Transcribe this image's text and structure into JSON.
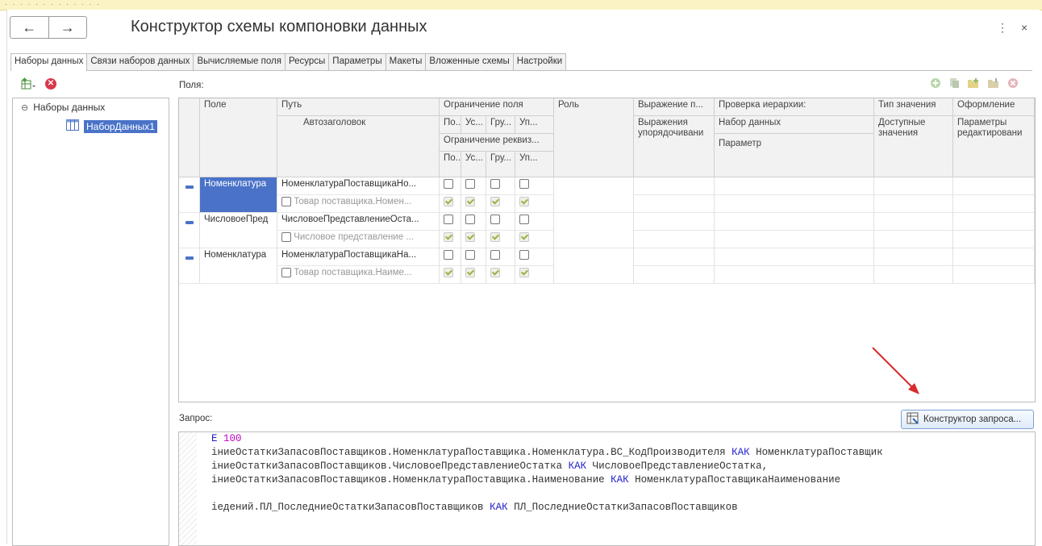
{
  "window": {
    "title": "Конструктор схемы компоновки данных",
    "back_icon": "←",
    "forward_icon": "→",
    "more_icon": "⋮",
    "close_icon": "×"
  },
  "tabs": [
    {
      "label": "Наборы данных",
      "active": true
    },
    {
      "label": "Связи наборов данных"
    },
    {
      "label": "Вычисляемые поля"
    },
    {
      "label": "Ресурсы"
    },
    {
      "label": "Параметры"
    },
    {
      "label": "Макеты"
    },
    {
      "label": "Вложенные схемы"
    },
    {
      "label": "Настройки"
    }
  ],
  "tree": {
    "root": "Наборы данных",
    "collapse_icon": "⊖",
    "item": "НаборДанных1"
  },
  "fields_label": "Поля:",
  "grid": {
    "headers": {
      "field": "Поле",
      "path": "Путь",
      "autotitle": "Автозаголовок",
      "field_restriction": "Ограничение поля",
      "attr_restriction": "Ограничение реквиз...",
      "r1": "По...",
      "r2": "Ус...",
      "r3": "Гру...",
      "r4": "Уп...",
      "role": "Роль",
      "expr_p": "Выражение п...",
      "expr_order": "Выражения упорядочивани",
      "hier_check": "Проверка иерархии:",
      "dataset": "Набор данных",
      "param": "Параметр",
      "value_type": "Тип значения",
      "avail_values": "Доступные значения",
      "format": "Оформление",
      "edit_params": "Параметры редактировани"
    },
    "rows": [
      {
        "field": "Номенклатура",
        "path": "НоменклатураПоставщикаНо...",
        "title": "Товар поставщика.Номен..."
      },
      {
        "field": "ЧисловоеПред",
        "path": "ЧисловоеПредставлениеОста...",
        "title": "Числовое представление ..."
      },
      {
        "field": "Номенклатура",
        "path": "НоменклатураПоставщикаНа...",
        "title": "Товар поставщика.Наиме..."
      }
    ]
  },
  "query_label": "Запрос:",
  "query_button": "Конструктор запроса...",
  "code": {
    "l1_kw": "E",
    "l1_num": "100",
    "l2a": "іниеОстаткиЗапасовПоставщиков.НоменклатураПоставщика.Номенклатура.ВС_КодПроизводителя ",
    "l2_kw": "КАК",
    "l2b": " НоменклатураПоставщик",
    "l3a": "іниеОстаткиЗапасовПоставщиков.ЧисловоеПредставлениеОстатка ",
    "l3_kw": "КАК",
    "l3b": " ЧисловоеПредставлениеОстатка,",
    "l4a": "іниеОстаткиЗапасовПоставщиков.НоменклатураПоставщика.Наименование ",
    "l4_kw": "КАК",
    "l4b": " НоменклатураПоставщикаНаименование",
    "l6a": "іедений.ПЛ_ПоследниеОстаткиЗапасовПоставщиков ",
    "l6_kw": "КАК",
    "l6b": " ПЛ_ПоследниеОстаткиЗапасовПоставщиков"
  },
  "colors": {
    "selection": "#4a73c8",
    "arrow": "#d92b2b",
    "keyword": "#2020c8",
    "number": "#c000c0"
  }
}
